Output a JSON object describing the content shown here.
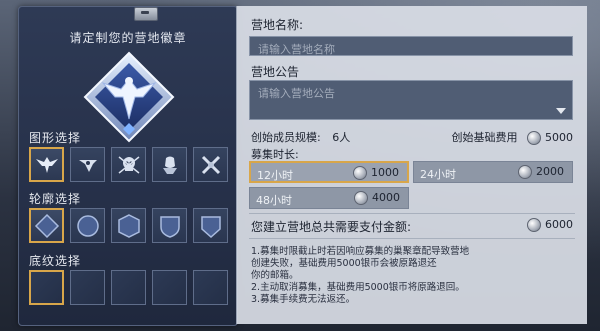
{
  "badge_panel": {
    "title": "请定制您的营地徽章",
    "shape_section": "图形选择",
    "outline_section": "轮廓选择",
    "texture_section": "底纹选择",
    "shape_options": [
      "eagle-icon",
      "bird-head-icon",
      "skull-icon",
      "fist-icon",
      "crossed-swords-icon"
    ],
    "outline_options": [
      "diamond-outline-icon",
      "circle-outline-icon",
      "hexagon-outline-icon",
      "shield-outline-icon",
      "pentagon-outline-icon"
    ],
    "selected_shape": 0,
    "selected_outline": 0,
    "selected_texture": 0
  },
  "form": {
    "name_label": "营地名称:",
    "name_placeholder": "请输入营地名称",
    "notice_label": "营地公告",
    "notice_placeholder": "请输入营地公告",
    "members_label": "创始成员规模:",
    "members_value": "6人",
    "base_fee_label": "创始基础费用",
    "base_fee_value": "5000",
    "duration_label": "募集时长:",
    "durations": [
      {
        "label": "12小时",
        "cost": "1000",
        "selected": true
      },
      {
        "label": "24小时",
        "cost": "2000",
        "selected": false
      },
      {
        "label": "48小时",
        "cost": "4000",
        "selected": false
      }
    ],
    "total_label": "您建立营地总共需要支付金额:",
    "total_value": "6000",
    "notes": [
      "1.募集时限截止时若因响应募集的巢聚章配导致营地",
      "创建失败，基础费用5000银币会被原路退还",
      "你的邮箱。",
      "2.主动取消募集，基础费用5000银币将原路退回。",
      "3.募集手续费无法返还。"
    ]
  },
  "colors": {
    "accent_gold": "#d8a64a",
    "panel_blue": "#2e3a55",
    "form_bg": "#d8dde5"
  }
}
